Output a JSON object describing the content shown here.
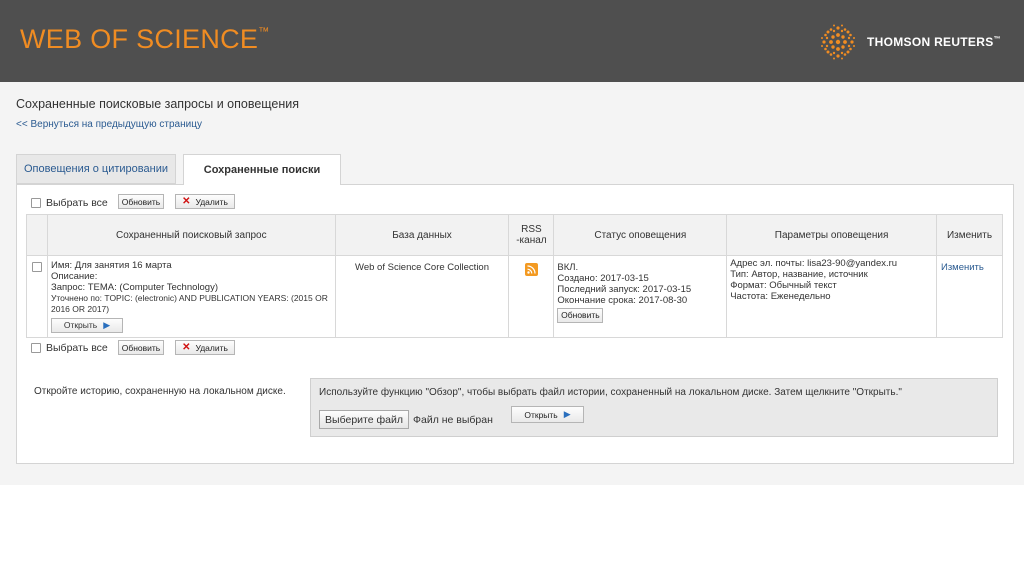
{
  "header": {
    "brand": "WEB OF SCIENCE",
    "brand_tm": "™",
    "partner": "THOMSON REUTERS",
    "partner_tm": "™",
    "brand_color": "#f08c22",
    "header_bg": "#4f4f4f"
  },
  "page": {
    "title": "Сохраненные поисковые запросы и оповещения",
    "back_link": "<< Вернуться на предыдущую страницу"
  },
  "tabs": [
    {
      "label": "Оповещения о цитировании",
      "active": false
    },
    {
      "label": "Сохраненные поиски",
      "active": true
    }
  ],
  "controls": {
    "select_all": "Выбрать все",
    "update": "Обновить",
    "delete": "Удалить"
  },
  "table": {
    "columns": [
      "Сохраненный поисковый запрос",
      "База данных",
      "RSS -канал",
      "Статус оповещения",
      "Параметры оповещения",
      "Изменить"
    ],
    "rows": [
      {
        "query_name": "Имя: Для занятия 16 марта",
        "description": "Описание:",
        "query": "Запрос: ТЕМА: (Computer Technology)",
        "refined": "Уточнено по: TOPIC: (electronic) AND PUBLICATION YEARS: (2015 OR 2016 OR 2017)",
        "open_label": "Открыть",
        "database": "Web of Science Core Collection",
        "rss_icon": "rss-icon",
        "status": "ВКЛ.",
        "created": "Создано: 2017-03-15",
        "last_run": "Последний запуск: 2017-03-15",
        "expires": "Окончание срока: 2017-08-30",
        "status_update": "Обновить",
        "email": "Адрес эл. почты: lisa23-90@yandex.ru",
        "type": "Тип: Автор, название, источник",
        "format": "Формат: Обычный текст",
        "frequency": "Частота: Еженедельно",
        "edit": "Изменить"
      }
    ]
  },
  "history": {
    "label": "Откройте историю, сохраненную на локальном диске.",
    "hint": "Используйте функцию \"Обзор\", чтобы выбрать файл истории, сохраненный на локальном диске. Затем щелкните \"Открыть.\"",
    "choose_file": "Выберите файл",
    "no_file": "Файл не выбран",
    "open": "Открыть"
  }
}
